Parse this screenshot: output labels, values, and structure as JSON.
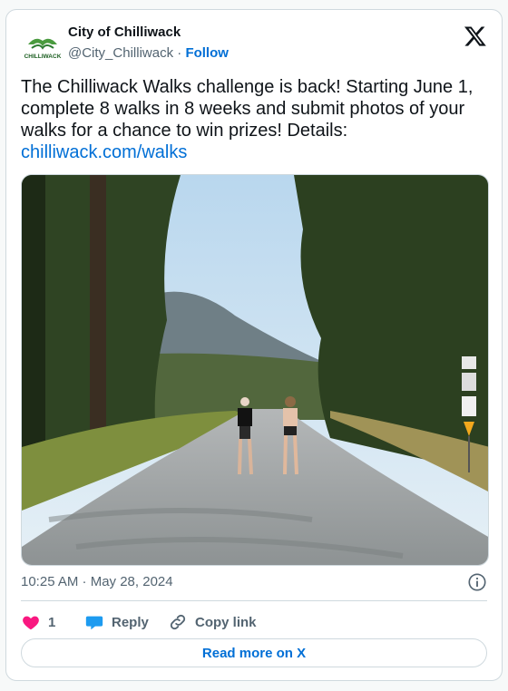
{
  "author": {
    "name": "City of Chilliwack",
    "handle": "@City_Chilliwack",
    "separator": "·",
    "follow_label": "Follow",
    "avatar_text": "CHILLIWACK"
  },
  "tweet": {
    "text": "The Chilliwack Walks challenge is back! Starting June 1, complete 8 walks in 8 weeks and submit photos of your walks for a chance to win prizes! Details:",
    "link": "chilliwack.com/walks",
    "timestamp": "10:25 AM · May 28, 2024"
  },
  "actions": {
    "like_count": "1",
    "reply_label": "Reply",
    "copy_label": "Copy link"
  },
  "read_more_label": "Read more on X",
  "colors": {
    "link": "#006fd6",
    "like": "#f91880",
    "reply": "#1d9bf0",
    "brand_green": "#4a9b3f"
  },
  "icons": [
    "x-logo-icon",
    "info-icon",
    "heart-icon",
    "reply-bubble-icon",
    "link-icon"
  ]
}
